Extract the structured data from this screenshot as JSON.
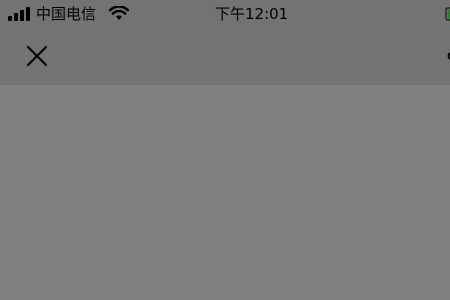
{
  "status_bar": {
    "carrier": "中国电信",
    "time": "下午12:01",
    "signal_icon": "signal-bars-icon",
    "wifi_icon": "wifi-icon",
    "battery_icon": "battery-icon"
  },
  "nav": {
    "close_icon": "close-icon"
  },
  "colors": {
    "header_bg": "#737373",
    "body_bg": "#808080",
    "text": "#000000"
  }
}
